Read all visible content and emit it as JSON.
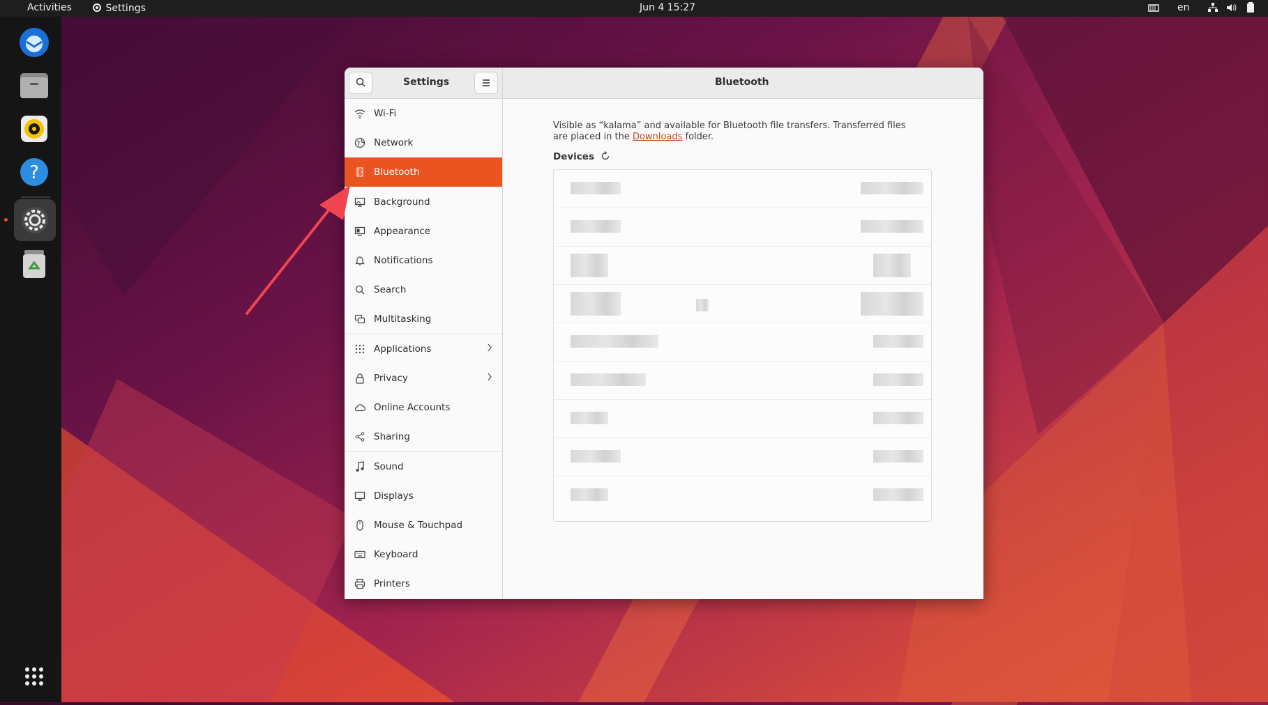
{
  "topbar": {
    "activities": "Activities",
    "app_name": "Settings",
    "datetime": "Jun 4  15:27",
    "language": "en"
  },
  "dock": {
    "items": [
      "thunderbird-icon",
      "files-icon",
      "rhythmbox-icon",
      "help-icon",
      "settings-icon",
      "trash-icon"
    ],
    "show_apps": "app-grid-icon"
  },
  "window": {
    "sidebar_title": "Settings",
    "page_title": "Bluetooth",
    "bluetooth_enabled": true
  },
  "sidebar": {
    "items": [
      {
        "label": "Wi-Fi",
        "icon": "wifi-icon"
      },
      {
        "label": "Network",
        "icon": "network-icon"
      },
      {
        "label": "Bluetooth",
        "icon": "bluetooth-icon",
        "selected": true
      },
      {
        "label": "Background",
        "icon": "background-icon"
      },
      {
        "label": "Appearance",
        "icon": "appearance-icon"
      },
      {
        "label": "Notifications",
        "icon": "bell-icon"
      },
      {
        "label": "Search",
        "icon": "search-icon"
      },
      {
        "label": "Multitasking",
        "icon": "multitasking-icon"
      },
      {
        "label": "Applications",
        "icon": "apps-grid-icon",
        "chevron": true
      },
      {
        "label": "Privacy",
        "icon": "lock-icon",
        "chevron": true
      },
      {
        "label": "Online Accounts",
        "icon": "cloud-icon"
      },
      {
        "label": "Sharing",
        "icon": "share-icon"
      },
      {
        "label": "Sound",
        "icon": "music-note-icon"
      },
      {
        "label": "Displays",
        "icon": "display-icon"
      },
      {
        "label": "Mouse & Touchpad",
        "icon": "mouse-icon"
      },
      {
        "label": "Keyboard",
        "icon": "keyboard-icon"
      },
      {
        "label": "Printers",
        "icon": "printer-icon"
      }
    ]
  },
  "content": {
    "visibility_text_1": "Visible as “kalama” and available for Bluetooth file transfers. Transferred files are placed in the ",
    "downloads_link": "Downloads",
    "visibility_text_2": " folder.",
    "devices_label": "Devices"
  },
  "colors": {
    "accent": "#e95420",
    "arrow": "#f0454f"
  }
}
